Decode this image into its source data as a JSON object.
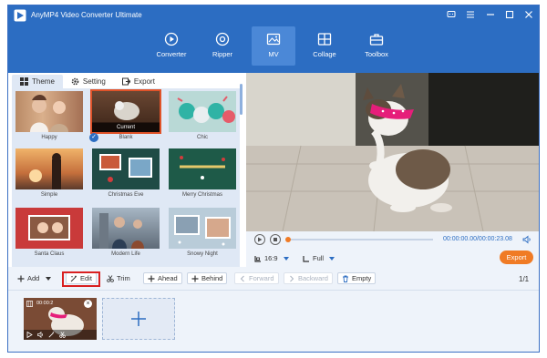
{
  "app": {
    "title": "AnyMP4 Video Converter Ultimate",
    "accent": "#2c6dc2",
    "orange": "#f07b25"
  },
  "nav": [
    {
      "label": "Converter",
      "icon": "converter-icon"
    },
    {
      "label": "Ripper",
      "icon": "disc-icon"
    },
    {
      "label": "MV",
      "icon": "mv-image-icon",
      "active": true
    },
    {
      "label": "Collage",
      "icon": "collage-grid-icon"
    },
    {
      "label": "Toolbox",
      "icon": "toolbox-icon"
    }
  ],
  "tabs": {
    "theme": "Theme",
    "setting": "Setting",
    "export": "Export"
  },
  "themes": [
    {
      "label": "Happy"
    },
    {
      "label": "Blank",
      "badge": "Current",
      "selected": true
    },
    {
      "label": "Chic"
    },
    {
      "label": "Simple"
    },
    {
      "label": "Christmas Eve"
    },
    {
      "label": "Merry Christmas"
    },
    {
      "label": "Santa Claus"
    },
    {
      "label": "Modern Life"
    },
    {
      "label": "Snowy Night"
    }
  ],
  "player": {
    "time": "00:00:00.00/00:00:23.08",
    "aspect": "16:9",
    "mode": "Full",
    "export_label": "Export",
    "progress": 0
  },
  "toolbar": {
    "add": "Add",
    "edit": "Edit",
    "trim": "Trim",
    "ahead": "Ahead",
    "behind": "Behind",
    "forward": "Forward",
    "backward": "Backward",
    "empty": "Empty",
    "pager": "1/1"
  },
  "clip": {
    "time": "00:00:2"
  }
}
